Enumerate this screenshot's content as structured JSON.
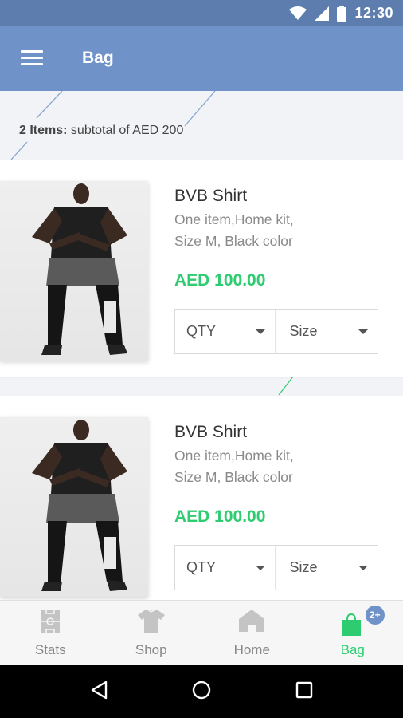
{
  "status_bar": {
    "time": "12:30"
  },
  "app_bar": {
    "title": "Bag"
  },
  "summary": {
    "count_label": "2 Items:",
    "subtotal_text": " subtotal of AED 200"
  },
  "items": [
    {
      "name": "BVB Shirt",
      "desc_line1": "One item,Home kit,",
      "desc_line2": "Size M, Black color",
      "price": "AED 100.00",
      "qty_label": "QTY",
      "size_label": "Size"
    },
    {
      "name": "BVB Shirt",
      "desc_line1": "One item,Home kit,",
      "desc_line2": "Size M, Black color",
      "price": "AED 100.00",
      "qty_label": "QTY",
      "size_label": "Size"
    }
  ],
  "bottom_nav": {
    "items": [
      {
        "label": "Stats",
        "icon": "stats-icon"
      },
      {
        "label": "Shop",
        "icon": "shirt-icon"
      },
      {
        "label": "Home",
        "icon": "home-icon"
      },
      {
        "label": "Bag",
        "icon": "bag-icon",
        "badge": "2+"
      }
    ],
    "active": "Bag"
  },
  "colors": {
    "primary": "#6f93c9",
    "status": "#5c7dad",
    "accent": "#2ecc71"
  }
}
